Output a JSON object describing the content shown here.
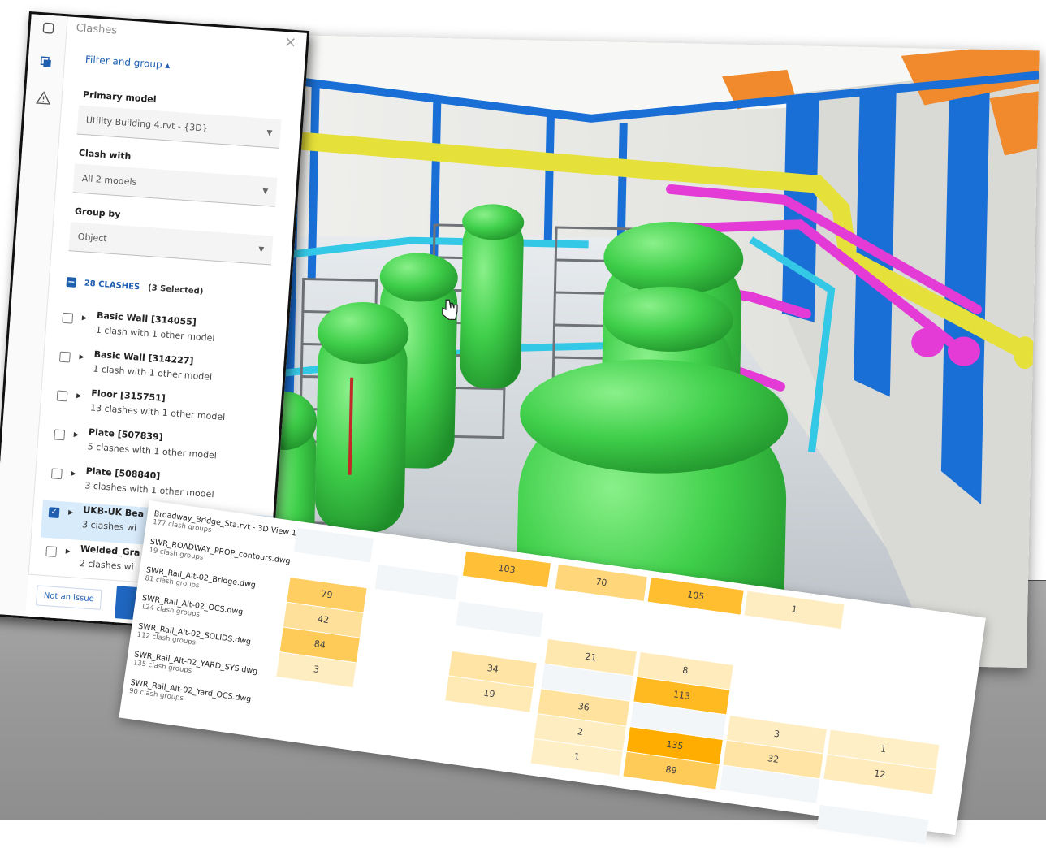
{
  "panel": {
    "title": "Clashes",
    "close_icon": "×",
    "filter_toggle": "Filter and group ▴",
    "primary_model_label": "Primary model",
    "primary_model_value": "Utility Building 4.rvt - {3D}",
    "clash_with_label": "Clash with",
    "clash_with_value": "All 2 models",
    "group_by_label": "Group by",
    "group_by_value": "Object",
    "clash_count": "28 CLASHES",
    "selected_note": "(3 Selected)",
    "items": [
      {
        "name": "Basic Wall [314055]",
        "sub": "1 clash with 1 other model",
        "checked": false
      },
      {
        "name": "Basic Wall [314227]",
        "sub": "1 clash with 1 other model",
        "checked": false
      },
      {
        "name": "Floor [315751]",
        "sub": "13 clashes with 1 other model",
        "checked": false
      },
      {
        "name": "Plate [507839]",
        "sub": "5 clashes with 1 other model",
        "checked": false
      },
      {
        "name": "Plate [508840]",
        "sub": "3 clashes with 1 other model",
        "checked": false
      },
      {
        "name": "UKB-UK Bea",
        "sub": "3 clashes wi",
        "checked": true
      },
      {
        "name": "Welded_Gra",
        "sub": "2 clashes wi",
        "checked": false
      }
    ],
    "not_issue_label": "Not an issue"
  },
  "matrix": {
    "rows": [
      {
        "name": "Broadway_Bridge_Sta.rvt - 3D View 1",
        "sub": "177 clash groups"
      },
      {
        "name": "SWR_ROADWAY_PROP_contours.dwg",
        "sub": "19 clash groups"
      },
      {
        "name": "SWR_Rail_Alt-02_Bridge.dwg",
        "sub": "81 clash groups"
      },
      {
        "name": "SWR_Rail_Alt-02_OCS.dwg",
        "sub": "124 clash groups"
      },
      {
        "name": "SWR_Rail_Alt-02_SOLIDS.dwg",
        "sub": "112 clash groups"
      },
      {
        "name": "SWR_Rail_Alt-02_YARD_SYS.dwg",
        "sub": "135 clash groups"
      },
      {
        "name": "SWR_Rail_Alt-02_Yard_OCS.dwg",
        "sub": "90 clash groups"
      }
    ],
    "cells": [
      {
        "row": 0,
        "col": 0,
        "value": "",
        "level": 0.03
      },
      {
        "row": 0,
        "col": 2,
        "value": "103",
        "level": 0.75
      },
      {
        "row": 0,
        "col": 3,
        "value": "70",
        "level": 0.45
      },
      {
        "row": 0,
        "col": 4,
        "value": "105",
        "level": 0.78
      },
      {
        "row": 0,
        "col": 5,
        "value": "1",
        "level": 0.12
      },
      {
        "row": 1,
        "col": 1,
        "value": "",
        "level": 0.03
      },
      {
        "row": 2,
        "col": 0,
        "value": "79",
        "level": 0.55
      },
      {
        "row": 2,
        "col": 2,
        "value": "",
        "level": 0.03
      },
      {
        "row": 3,
        "col": 0,
        "value": "42",
        "level": 0.3
      },
      {
        "row": 3,
        "col": 3,
        "value": "21",
        "level": 0.2
      },
      {
        "row": 3,
        "col": 4,
        "value": "8",
        "level": 0.15
      },
      {
        "row": 4,
        "col": 0,
        "value": "84",
        "level": 0.6
      },
      {
        "row": 4,
        "col": 2,
        "value": "34",
        "level": 0.25
      },
      {
        "row": 4,
        "col": 3,
        "value": "",
        "level": 0.03
      },
      {
        "row": 4,
        "col": 4,
        "value": "113",
        "level": 0.85
      },
      {
        "row": 5,
        "col": 0,
        "value": "3",
        "level": 0.12
      },
      {
        "row": 5,
        "col": 2,
        "value": "19",
        "level": 0.18
      },
      {
        "row": 5,
        "col": 3,
        "value": "36",
        "level": 0.28
      },
      {
        "row": 5,
        "col": 4,
        "value": "",
        "level": 0.03
      },
      {
        "row": 5,
        "col": 5,
        "value": "3",
        "level": 0.12
      },
      {
        "row": 5,
        "col": 6,
        "value": "1",
        "level": 0.1
      },
      {
        "row": 6,
        "col": 3,
        "value": "2",
        "level": 0.12
      },
      {
        "row": 6,
        "col": 4,
        "value": "135",
        "level": 1.0
      },
      {
        "row": 6,
        "col": 5,
        "value": "32",
        "level": 0.25
      },
      {
        "row": 6,
        "col": 6,
        "value": "12",
        "level": 0.15
      },
      {
        "row": 7,
        "col": 3,
        "value": "1",
        "level": 0.1
      },
      {
        "row": 7,
        "col": 4,
        "value": "89",
        "level": 0.6
      },
      {
        "row": 7,
        "col": 5,
        "value": "",
        "level": 0.03
      },
      {
        "row": 8,
        "col": 6,
        "value": "",
        "level": 0.03
      }
    ]
  },
  "colors": {
    "accent_blue": "#1f5fb0",
    "steel_blue": "#1a6fd6",
    "tank_green": "#3fcf4a",
    "pipe_magenta": "#e43ad6",
    "pipe_yellow": "#e6e03a",
    "pipe_cyan": "#33c8e6",
    "roof_orange": "#f08a2c",
    "heat_max": "#ffae00",
    "heat_min": "#fff6dc"
  }
}
